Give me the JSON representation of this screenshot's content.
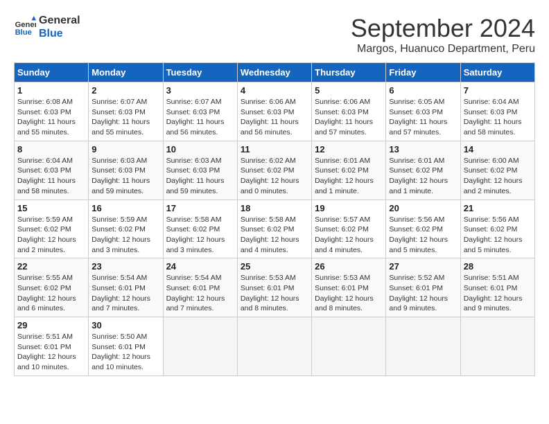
{
  "header": {
    "logo_line1": "General",
    "logo_line2": "Blue",
    "month_title": "September 2024",
    "subtitle": "Margos, Huanuco Department, Peru"
  },
  "calendar": {
    "days_of_week": [
      "Sunday",
      "Monday",
      "Tuesday",
      "Wednesday",
      "Thursday",
      "Friday",
      "Saturday"
    ],
    "weeks": [
      [
        {
          "day": "1",
          "info": "Sunrise: 6:08 AM\nSunset: 6:03 PM\nDaylight: 11 hours\nand 55 minutes."
        },
        {
          "day": "2",
          "info": "Sunrise: 6:07 AM\nSunset: 6:03 PM\nDaylight: 11 hours\nand 55 minutes."
        },
        {
          "day": "3",
          "info": "Sunrise: 6:07 AM\nSunset: 6:03 PM\nDaylight: 11 hours\nand 56 minutes."
        },
        {
          "day": "4",
          "info": "Sunrise: 6:06 AM\nSunset: 6:03 PM\nDaylight: 11 hours\nand 56 minutes."
        },
        {
          "day": "5",
          "info": "Sunrise: 6:06 AM\nSunset: 6:03 PM\nDaylight: 11 hours\nand 57 minutes."
        },
        {
          "day": "6",
          "info": "Sunrise: 6:05 AM\nSunset: 6:03 PM\nDaylight: 11 hours\nand 57 minutes."
        },
        {
          "day": "7",
          "info": "Sunrise: 6:04 AM\nSunset: 6:03 PM\nDaylight: 11 hours\nand 58 minutes."
        }
      ],
      [
        {
          "day": "8",
          "info": "Sunrise: 6:04 AM\nSunset: 6:03 PM\nDaylight: 11 hours\nand 58 minutes."
        },
        {
          "day": "9",
          "info": "Sunrise: 6:03 AM\nSunset: 6:03 PM\nDaylight: 11 hours\nand 59 minutes."
        },
        {
          "day": "10",
          "info": "Sunrise: 6:03 AM\nSunset: 6:03 PM\nDaylight: 11 hours\nand 59 minutes."
        },
        {
          "day": "11",
          "info": "Sunrise: 6:02 AM\nSunset: 6:02 PM\nDaylight: 12 hours\nand 0 minutes."
        },
        {
          "day": "12",
          "info": "Sunrise: 6:01 AM\nSunset: 6:02 PM\nDaylight: 12 hours\nand 1 minute."
        },
        {
          "day": "13",
          "info": "Sunrise: 6:01 AM\nSunset: 6:02 PM\nDaylight: 12 hours\nand 1 minute."
        },
        {
          "day": "14",
          "info": "Sunrise: 6:00 AM\nSunset: 6:02 PM\nDaylight: 12 hours\nand 2 minutes."
        }
      ],
      [
        {
          "day": "15",
          "info": "Sunrise: 5:59 AM\nSunset: 6:02 PM\nDaylight: 12 hours\nand 2 minutes."
        },
        {
          "day": "16",
          "info": "Sunrise: 5:59 AM\nSunset: 6:02 PM\nDaylight: 12 hours\nand 3 minutes."
        },
        {
          "day": "17",
          "info": "Sunrise: 5:58 AM\nSunset: 6:02 PM\nDaylight: 12 hours\nand 3 minutes."
        },
        {
          "day": "18",
          "info": "Sunrise: 5:58 AM\nSunset: 6:02 PM\nDaylight: 12 hours\nand 4 minutes."
        },
        {
          "day": "19",
          "info": "Sunrise: 5:57 AM\nSunset: 6:02 PM\nDaylight: 12 hours\nand 4 minutes."
        },
        {
          "day": "20",
          "info": "Sunrise: 5:56 AM\nSunset: 6:02 PM\nDaylight: 12 hours\nand 5 minutes."
        },
        {
          "day": "21",
          "info": "Sunrise: 5:56 AM\nSunset: 6:02 PM\nDaylight: 12 hours\nand 5 minutes."
        }
      ],
      [
        {
          "day": "22",
          "info": "Sunrise: 5:55 AM\nSunset: 6:02 PM\nDaylight: 12 hours\nand 6 minutes."
        },
        {
          "day": "23",
          "info": "Sunrise: 5:54 AM\nSunset: 6:01 PM\nDaylight: 12 hours\nand 7 minutes."
        },
        {
          "day": "24",
          "info": "Sunrise: 5:54 AM\nSunset: 6:01 PM\nDaylight: 12 hours\nand 7 minutes."
        },
        {
          "day": "25",
          "info": "Sunrise: 5:53 AM\nSunset: 6:01 PM\nDaylight: 12 hours\nand 8 minutes."
        },
        {
          "day": "26",
          "info": "Sunrise: 5:53 AM\nSunset: 6:01 PM\nDaylight: 12 hours\nand 8 minutes."
        },
        {
          "day": "27",
          "info": "Sunrise: 5:52 AM\nSunset: 6:01 PM\nDaylight: 12 hours\nand 9 minutes."
        },
        {
          "day": "28",
          "info": "Sunrise: 5:51 AM\nSunset: 6:01 PM\nDaylight: 12 hours\nand 9 minutes."
        }
      ],
      [
        {
          "day": "29",
          "info": "Sunrise: 5:51 AM\nSunset: 6:01 PM\nDaylight: 12 hours\nand 10 minutes."
        },
        {
          "day": "30",
          "info": "Sunrise: 5:50 AM\nSunset: 6:01 PM\nDaylight: 12 hours\nand 10 minutes."
        },
        {
          "day": "",
          "info": ""
        },
        {
          "day": "",
          "info": ""
        },
        {
          "day": "",
          "info": ""
        },
        {
          "day": "",
          "info": ""
        },
        {
          "day": "",
          "info": ""
        }
      ]
    ]
  }
}
